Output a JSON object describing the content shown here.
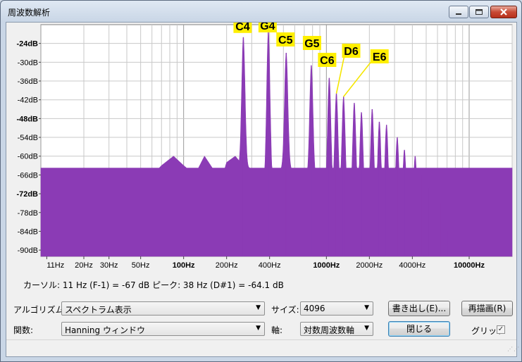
{
  "window": {
    "title": "周波数解析"
  },
  "chart_data": {
    "type": "area",
    "title": "",
    "xlabel": "",
    "ylabel": "",
    "x_scale": "log",
    "xlim": [
      10,
      20000
    ],
    "ylim": [
      -92,
      -18
    ],
    "grid": true,
    "fill_color": "#8b3bb5",
    "y_ticks": [
      "-24dB",
      "-30dB",
      "-36dB",
      "-42dB",
      "-48dB",
      "-54dB",
      "-60dB",
      "-66dB",
      "-72dB",
      "-78dB",
      "-84dB",
      "-90dB"
    ],
    "y_tick_values": [
      -24,
      -30,
      -36,
      -42,
      -48,
      -54,
      -60,
      -66,
      -72,
      -78,
      -84,
      -90
    ],
    "x_ticks": [
      "11Hz",
      "20Hz",
      "30Hz",
      "50Hz",
      "100Hz",
      "200Hz",
      "400Hz",
      "1000Hz",
      "2000Hz",
      "4000Hz",
      "10000Hz"
    ],
    "x_tick_values": [
      11,
      20,
      30,
      50,
      100,
      200,
      400,
      1000,
      2000,
      4000,
      10000
    ],
    "x_ticks_bold": [
      false,
      false,
      false,
      false,
      true,
      false,
      false,
      true,
      false,
      false,
      true
    ],
    "y_ticks_bold": [
      true,
      false,
      false,
      false,
      true,
      false,
      false,
      false,
      true,
      false,
      false,
      false
    ],
    "envelope": [
      {
        "f": 10,
        "db": -66
      },
      {
        "f": 14,
        "db": -70
      },
      {
        "f": 20,
        "db": -73
      },
      {
        "f": 26,
        "db": -72
      },
      {
        "f": 33,
        "db": -67
      },
      {
        "f": 38,
        "db": -64
      },
      {
        "f": 45,
        "db": -66
      },
      {
        "f": 55,
        "db": -68
      },
      {
        "f": 70,
        "db": -63
      },
      {
        "f": 85,
        "db": -60
      },
      {
        "f": 100,
        "db": -63
      },
      {
        "f": 120,
        "db": -66
      },
      {
        "f": 140,
        "db": -60
      },
      {
        "f": 160,
        "db": -64
      },
      {
        "f": 180,
        "db": -69
      },
      {
        "f": 200,
        "db": -62
      },
      {
        "f": 230,
        "db": -60
      },
      {
        "f": 250,
        "db": -62
      },
      {
        "f": 300,
        "db": -69
      },
      {
        "f": 350,
        "db": -72
      },
      {
        "f": 500,
        "db": -64
      },
      {
        "f": 700,
        "db": -66
      },
      {
        "f": 1000,
        "db": -72
      },
      {
        "f": 1500,
        "db": -76
      },
      {
        "f": 2000,
        "db": -78
      },
      {
        "f": 3000,
        "db": -80
      },
      {
        "f": 5000,
        "db": -86
      },
      {
        "f": 7000,
        "db": -92
      }
    ],
    "peaks": [
      {
        "f": 262,
        "db": -22
      },
      {
        "f": 392,
        "db": -20
      },
      {
        "f": 523,
        "db": -27
      },
      {
        "f": 784,
        "db": -31
      },
      {
        "f": 1047,
        "db": -35
      },
      {
        "f": 1175,
        "db": -40
      },
      {
        "f": 1319,
        "db": -41
      },
      {
        "f": 1568,
        "db": -43
      },
      {
        "f": 1760,
        "db": -46
      },
      {
        "f": 2093,
        "db": -45
      },
      {
        "f": 2349,
        "db": -49
      },
      {
        "f": 2637,
        "db": -50
      },
      {
        "f": 3136,
        "db": -54
      },
      {
        "f": 3520,
        "db": -58
      },
      {
        "f": 4186,
        "db": -60
      },
      {
        "f": 4699,
        "db": -66
      },
      {
        "f": 5274,
        "db": -70
      },
      {
        "f": 6272,
        "db": -75
      },
      {
        "f": 7040,
        "db": -84
      }
    ],
    "annotations": [
      {
        "text": "C4",
        "f": 262,
        "db": -22,
        "arrow": false
      },
      {
        "text": "G4",
        "f": 392,
        "db": -20,
        "arrow": false
      },
      {
        "text": "C5",
        "f": 523,
        "db": -27,
        "arrow": false
      },
      {
        "text": "G5",
        "f": 784,
        "db": -31,
        "arrow": false
      },
      {
        "text": "C6",
        "f": 1047,
        "db": -35,
        "arrow": false
      },
      {
        "text": "D6",
        "f": 1175,
        "db": -40,
        "arrow": true
      },
      {
        "text": "E6",
        "f": 1319,
        "db": -41,
        "arrow": true
      }
    ]
  },
  "readout": {
    "text": "カーソル: 11 Hz (F-1) = -67 dB    ピーク: 38 Hz (D#1) = -64.1 dB"
  },
  "controls": {
    "algorithm_label": "アルゴリズム:",
    "algorithm_value": "スペクトラム表示",
    "size_label": "サイズ:",
    "size_value": "4096",
    "export_button": "書き出し(E)...",
    "replot_button": "再描画(R)",
    "function_label": "関数:",
    "function_value": "Hanning ウィンドウ",
    "axis_label": "軸:",
    "axis_value": "対数周波数軸",
    "close_button": "閉じる",
    "grid_label": "グリッド",
    "grid_checked": true
  },
  "icons": {
    "minimize": "minimize-icon",
    "maximize": "maximize-icon",
    "close": "close-icon",
    "dropdown": "chevron-down-icon"
  }
}
